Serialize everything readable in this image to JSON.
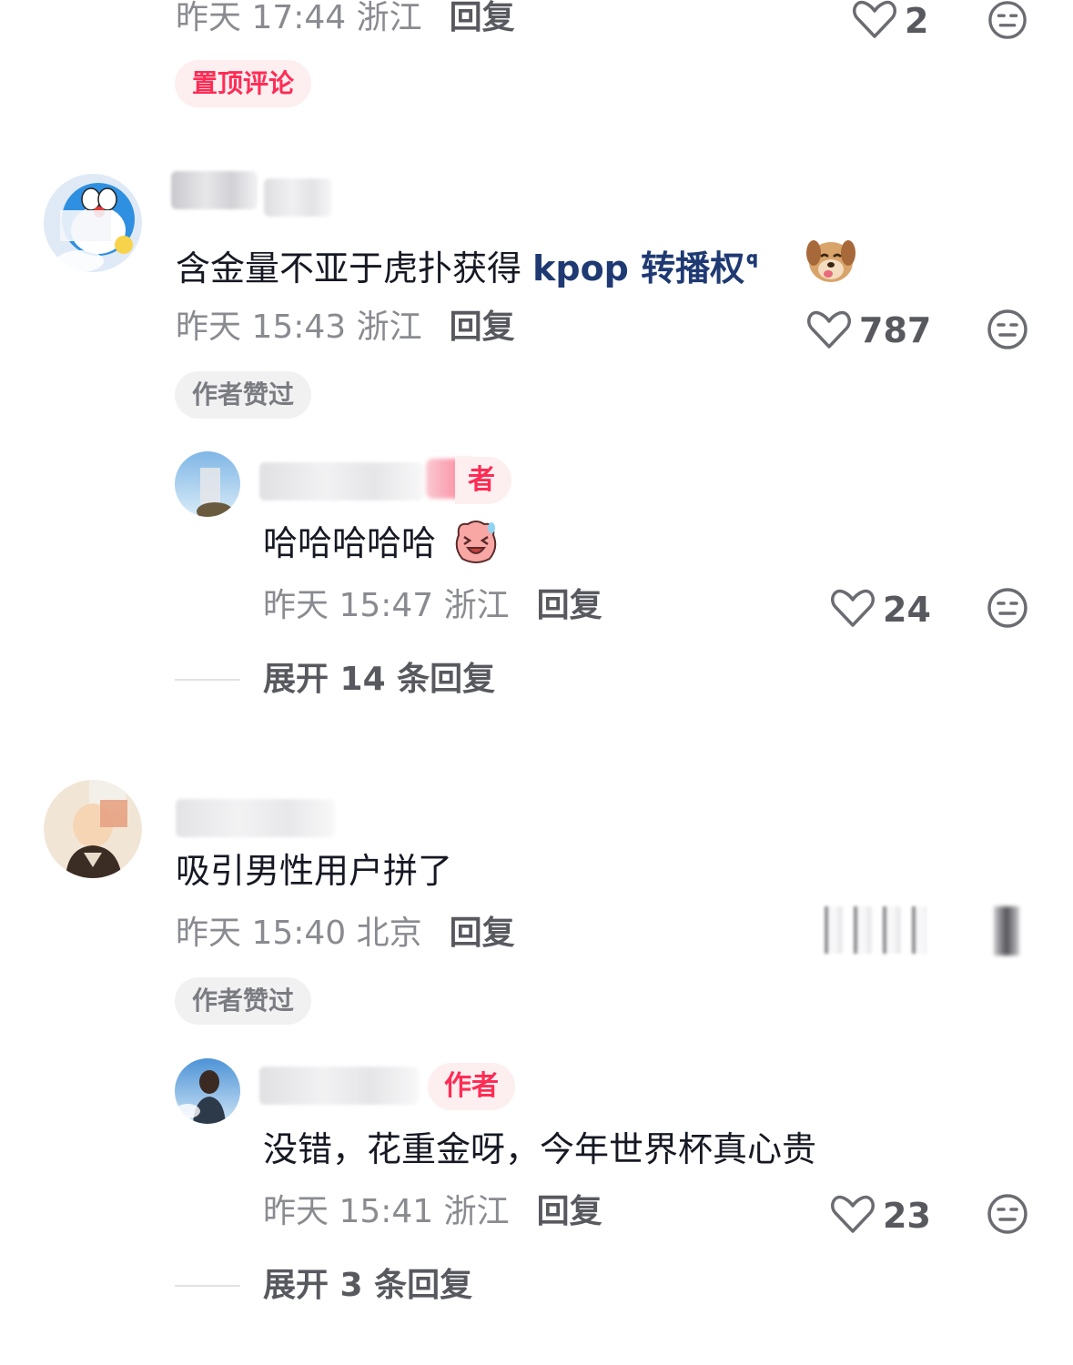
{
  "top_comment": {
    "meta_time": "昨天 17:44 浙江",
    "reply_label": "回复",
    "like_count": "2",
    "tag": "置顶评论"
  },
  "comment1": {
    "text": "含金量不亚于虎扑获得 ",
    "keyword": "kpop 转播权",
    "meta_time": "昨天 15:43 浙江",
    "reply_label": "回复",
    "like_count": "787",
    "tag": "作者赞过",
    "reply": {
      "author_tag": "者",
      "text": "哈哈哈哈哈",
      "meta_time": "昨天 15:47 浙江",
      "reply_label": "回复",
      "like_count": "24"
    },
    "expand_label": "展开 14 条回复"
  },
  "comment2": {
    "text": "吸引男性用户拼了",
    "meta_time": "昨天 15:40 北京",
    "reply_label": "回复",
    "tag": "作者赞过",
    "reply": {
      "author_tag": "作者",
      "text": "没错，花重金呀，今年世界杯真心贵",
      "meta_time": "昨天 15:41 浙江",
      "reply_label": "回复",
      "like_count": "23"
    },
    "expand_label": "展开 3 条回复"
  },
  "colors": {
    "accent": "#fe2c55",
    "keyword": "#1f3a73",
    "meta": "#8a8b91"
  },
  "icons": [
    "heart-icon",
    "meh-face-icon",
    "search-superscript-icon",
    "dog-sticker-icon",
    "laughing-sticker-icon"
  ]
}
